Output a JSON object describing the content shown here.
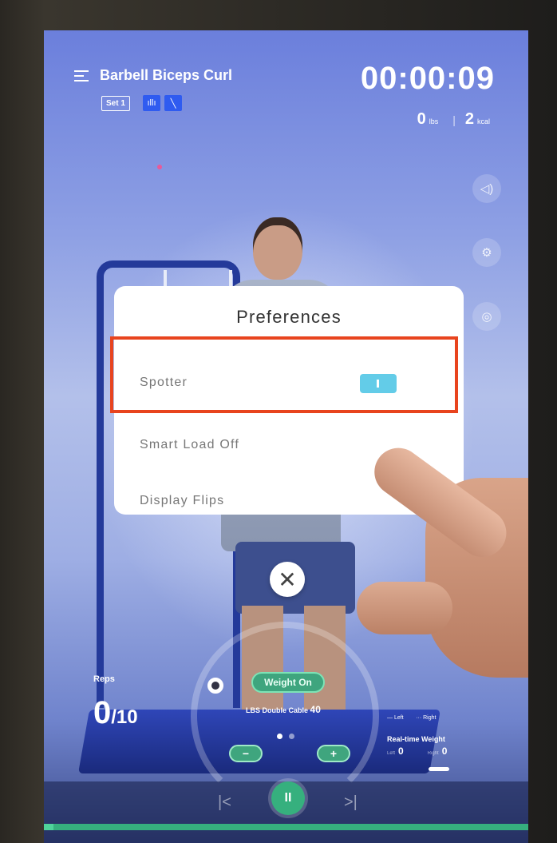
{
  "header": {
    "title": "Barbell Biceps Curl",
    "set_label": "Set 1",
    "timer": "00:00:09",
    "weight_value": "0",
    "weight_unit": "lbs",
    "kcal_value": "2",
    "kcal_unit": "kcal"
  },
  "preferences": {
    "title": "Preferences",
    "rows": [
      {
        "label": "Spotter",
        "enabled": true
      },
      {
        "label": "Smart Load Off"
      },
      {
        "label": "Display Flips"
      }
    ]
  },
  "workout": {
    "reps_label": "Reps",
    "reps_done": "0",
    "reps_total": "/10",
    "weight_on_label": "Weight On",
    "cable_label": "LBS Double Cable",
    "cable_weight": "40",
    "decrease_label": "−",
    "increase_label": "+",
    "legend_left": "— Left",
    "legend_right": "··· Right",
    "realtime_title": "Real-time Weight",
    "realtime_left_label": "Left",
    "realtime_left_value": "0",
    "realtime_right_label": "Right",
    "realtime_right_value": "0"
  },
  "playback": {
    "prev_label": "|<",
    "pause_label": "II",
    "next_label": ">|",
    "progress_fraction": 0.02
  },
  "colors": {
    "accent_green": "#36b07e",
    "toggle_on": "#63cce8",
    "highlight_red": "#e8441e",
    "badge_blue": "#2f5bf0"
  },
  "icons": {
    "menu": "menu-icon",
    "mode": "pulse-icon",
    "angle": "slash-icon",
    "volume": "volume-icon",
    "settings": "gear-icon",
    "camera": "camera-icon",
    "close": "close-icon"
  }
}
